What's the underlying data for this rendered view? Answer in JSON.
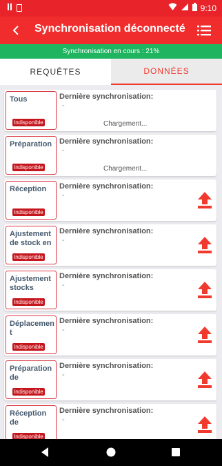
{
  "status_bar": {
    "time": "9:10"
  },
  "app_bar": {
    "title": "Synchronisation déconnecté"
  },
  "sync_banner": {
    "text": "Synchronisation en cours : 21%"
  },
  "tabs": [
    {
      "label": "REQUÊTES",
      "active": false
    },
    {
      "label": "DONNÉES",
      "active": true
    }
  ],
  "sync_label": "Dernière synchronisation:",
  "items": [
    {
      "name": "Tous",
      "badge": "Indisponible",
      "last_sync": "-",
      "loading": "Chargement..."
    },
    {
      "name": "Préparation",
      "badge": "Indisponible",
      "last_sync": "-",
      "loading": "Chargement..."
    },
    {
      "name": "Réception",
      "badge": "Indisponible",
      "last_sync": "-"
    },
    {
      "name": "Ajustement de stock en",
      "badge": "Indisponible",
      "last_sync": "-"
    },
    {
      "name": "Ajustement stocks",
      "badge": "Indisponible",
      "last_sync": "-"
    },
    {
      "name": "Déplacement",
      "badge": "Indisponible",
      "last_sync": "-"
    },
    {
      "name": "Préparation de",
      "badge": "Indisponible",
      "last_sync": "-"
    },
    {
      "name": "Réception de",
      "badge": "Indisponible",
      "last_sync": "-"
    }
  ],
  "colors": {
    "app_bar": "#f02c2c",
    "status_bar": "#e8232a",
    "sync_banner": "#1fb45f",
    "badge": "#c5161d",
    "accent": "#ef3b30"
  },
  "icons": {
    "back": "arrow-left-icon",
    "menu": "list-menu-icon",
    "upload": "upload-arrow-icon"
  }
}
